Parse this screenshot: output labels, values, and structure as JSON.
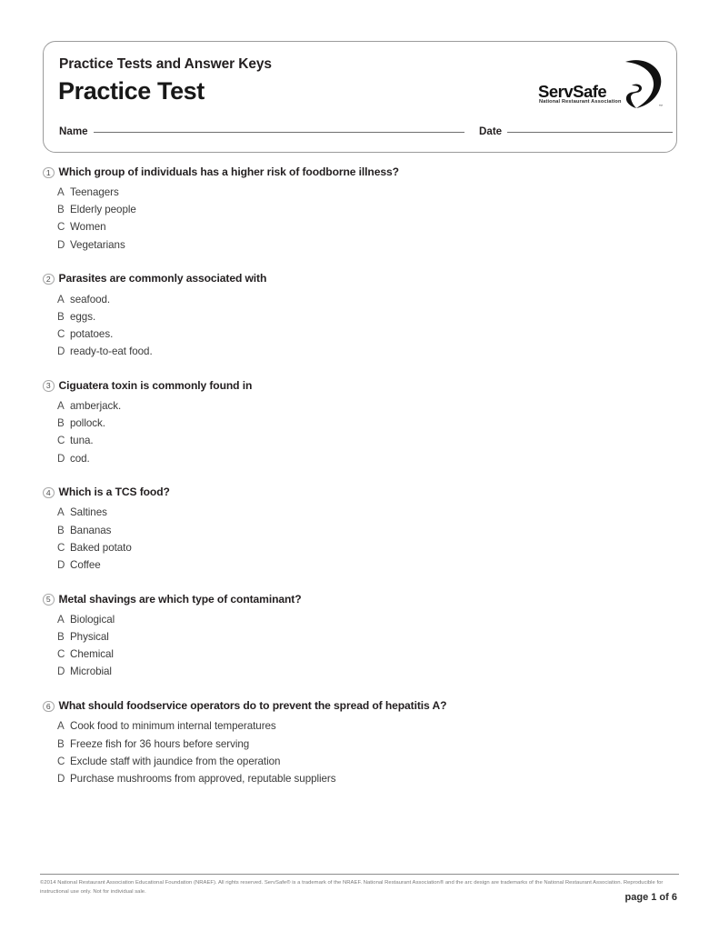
{
  "header": {
    "kicker": "Practice Tests and Answer Keys",
    "title": "Practice Test",
    "logo": {
      "wordmark": "ServSafe",
      "subtitle": "National Restaurant Association",
      "trademark": "®",
      "arc_icon": "servsafe-arc-swoosh"
    },
    "fields": [
      {
        "label": "Name",
        "value": "",
        "placeholder": ""
      },
      {
        "label": "Date",
        "value": "",
        "placeholder": ""
      }
    ]
  },
  "questions": [
    {
      "number": "1",
      "text": "Which group of individuals has a higher risk of foodborne illness?",
      "options": [
        {
          "letter": "A",
          "text": "Teenagers"
        },
        {
          "letter": "B",
          "text": "Elderly people"
        },
        {
          "letter": "C",
          "text": "Women"
        },
        {
          "letter": "D",
          "text": "Vegetarians"
        }
      ]
    },
    {
      "number": "2",
      "text": "Parasites are commonly associated with",
      "options": [
        {
          "letter": "A",
          "text": "seafood."
        },
        {
          "letter": "B",
          "text": "eggs."
        },
        {
          "letter": "C",
          "text": "potatoes."
        },
        {
          "letter": "D",
          "text": "ready-to-eat food."
        }
      ]
    },
    {
      "number": "3",
      "text": "Ciguatera toxin is commonly found in",
      "options": [
        {
          "letter": "A",
          "text": "amberjack."
        },
        {
          "letter": "B",
          "text": "pollock."
        },
        {
          "letter": "C",
          "text": "tuna."
        },
        {
          "letter": "D",
          "text": "cod."
        }
      ]
    },
    {
      "number": "4",
      "text": "Which is a TCS food?",
      "options": [
        {
          "letter": "A",
          "text": "Saltines"
        },
        {
          "letter": "B",
          "text": "Bananas"
        },
        {
          "letter": "C",
          "text": "Baked potato"
        },
        {
          "letter": "D",
          "text": "Coffee"
        }
      ]
    },
    {
      "number": "5",
      "text": "Metal shavings are which type of contaminant?",
      "options": [
        {
          "letter": "A",
          "text": "Biological"
        },
        {
          "letter": "B",
          "text": "Physical"
        },
        {
          "letter": "C",
          "text": "Chemical"
        },
        {
          "letter": "D",
          "text": "Microbial"
        }
      ]
    },
    {
      "number": "6",
      "text": "What should foodservice operators do to prevent the spread of hepatitis A?",
      "options": [
        {
          "letter": "A",
          "text": "Cook food to minimum internal temperatures"
        },
        {
          "letter": "B",
          "text": "Freeze fish for 36 hours before serving"
        },
        {
          "letter": "C",
          "text": "Exclude staff with jaundice from the operation"
        },
        {
          "letter": "D",
          "text": "Purchase mushrooms from approved, reputable suppliers"
        }
      ]
    }
  ],
  "footer": {
    "copyright": "©2014 National Restaurant Association Educational Foundation (NRAEF). All rights reserved. ServSafe® is a trademark of the NRAEF. National Restaurant Association® and the arc design are trademarks of the National Restaurant Association. Reproducible for instructional use only. Not for individual sale.",
    "page_label": "page 1 of 6"
  },
  "colors": {
    "text": "#231f20",
    "option_text": "#3a3a3a",
    "border": "#9b9b9b",
    "footer_text": "#7a7a7a",
    "background": "#ffffff"
  }
}
